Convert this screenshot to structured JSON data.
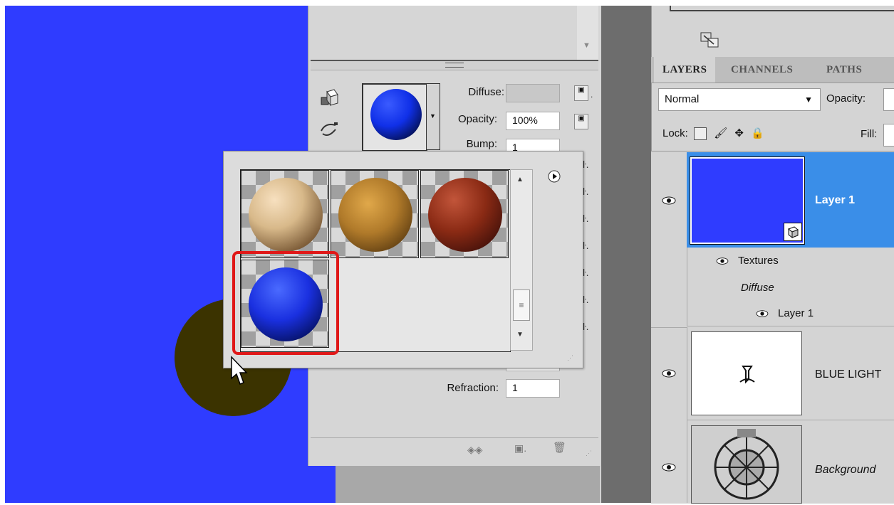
{
  "properties": {
    "diffuse_label": "Diffuse:",
    "opacity_label": "Opacity:",
    "opacity_value": "100%",
    "bump_label": "Bump:",
    "bump_value": "1",
    "refraction_label": "Refraction:",
    "refraction_value": "1"
  },
  "materials": {
    "items": [
      {
        "name": "beige-marble-sphere",
        "color": "#d8b98a"
      },
      {
        "name": "wood-bark-sphere",
        "color": "#b07a2a"
      },
      {
        "name": "rust-red-sphere",
        "color": "#8a2a14"
      },
      {
        "name": "blue-sphere",
        "color": "#1a30e0"
      }
    ],
    "selected_index": 3
  },
  "layers_panel": {
    "tabs": [
      "LAYERS",
      "CHANNELS",
      "PATHS"
    ],
    "active_tab": "LAYERS",
    "blend_mode": "Normal",
    "opacity_label": "Opacity:",
    "lock_label": "Lock:",
    "fill_label": "Fill:",
    "layers": [
      {
        "name": "Layer 1",
        "selected": true
      },
      {
        "name": "BLUE LIGHT",
        "selected": false
      },
      {
        "name": "Background",
        "selected": false
      }
    ],
    "textures_label": "Textures",
    "diffuse_label": "Diffuse",
    "texture_layer_label": "Layer 1"
  },
  "colors": {
    "canvas": "#2f3cff",
    "selection": "#3a8ee8",
    "highlight": "#e01818"
  }
}
